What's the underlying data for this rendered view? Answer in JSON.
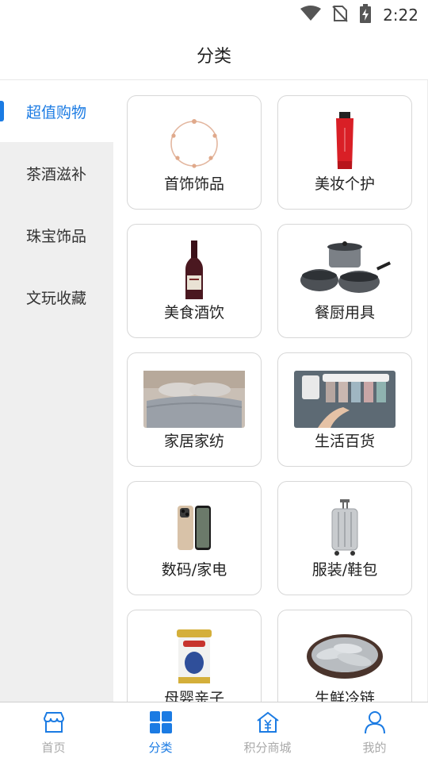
{
  "status_bar": {
    "time": "2:22",
    "icons": [
      "wifi-icon",
      "no-sim-icon",
      "battery-charging-icon"
    ]
  },
  "header": {
    "title": "分类"
  },
  "sidebar": {
    "items": [
      {
        "label": "超值购物",
        "active": true
      },
      {
        "label": "茶酒滋补",
        "active": false
      },
      {
        "label": "珠宝饰品",
        "active": false
      },
      {
        "label": "文玩收藏",
        "active": false
      }
    ]
  },
  "categories": [
    {
      "label": "首饰饰品",
      "image": "bracelet-image"
    },
    {
      "label": "美妆个护",
      "image": "lipstick-tube-image"
    },
    {
      "label": "美食酒饮",
      "image": "wine-bottle-image"
    },
    {
      "label": "餐厨用具",
      "image": "cookware-set-image"
    },
    {
      "label": "家居家纺",
      "image": "bedding-photo"
    },
    {
      "label": "生活百货",
      "image": "toothbrush-holder-photo"
    },
    {
      "label": "数码/家电",
      "image": "smartphone-image"
    },
    {
      "label": "服装/鞋包",
      "image": "suitcase-image"
    },
    {
      "label": "母婴亲子",
      "image": "milk-powder-can-image"
    },
    {
      "label": "生鲜冷链",
      "image": "fish-platter-image"
    }
  ],
  "tab_bar": {
    "tabs": [
      {
        "label": "首页",
        "icon": "store-icon",
        "active": false
      },
      {
        "label": "分类",
        "icon": "grid-icon",
        "active": true
      },
      {
        "label": "积分商城",
        "icon": "points-mall-icon",
        "active": false
      },
      {
        "label": "我的",
        "icon": "user-icon",
        "active": false
      }
    ]
  },
  "colors": {
    "accent": "#1b7be3",
    "sidebar_bg": "#efefef",
    "inactive_tab": "#aaaaaa"
  }
}
